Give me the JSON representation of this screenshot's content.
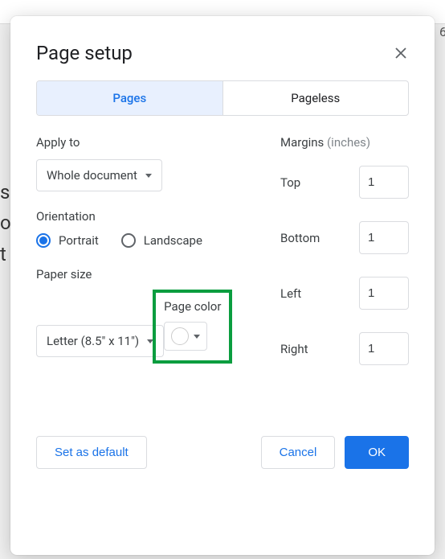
{
  "dialog": {
    "title": "Page setup",
    "tabs": {
      "pages": "Pages",
      "pageless": "Pageless"
    },
    "applyTo": {
      "label": "Apply to",
      "value": "Whole document"
    },
    "orientation": {
      "label": "Orientation",
      "portrait": "Portrait",
      "landscape": "Landscape",
      "selected": "portrait"
    },
    "paperSize": {
      "label": "Paper size",
      "value": "Letter (8.5\" x 11\")"
    },
    "pageColor": {
      "label": "Page color",
      "value": "#ffffff"
    },
    "margins": {
      "label": "Margins",
      "unit": "(inches)",
      "top": {
        "label": "Top",
        "value": "1"
      },
      "bottom": {
        "label": "Bottom",
        "value": "1"
      },
      "left": {
        "label": "Left",
        "value": "1"
      },
      "right": {
        "label": "Right",
        "value": "1"
      }
    },
    "buttons": {
      "setDefault": "Set as default",
      "cancel": "Cancel",
      "ok": "OK"
    }
  },
  "background": {
    "rulerNum": "6",
    "lines": [
      "s i",
      "ou",
      "t"
    ]
  }
}
